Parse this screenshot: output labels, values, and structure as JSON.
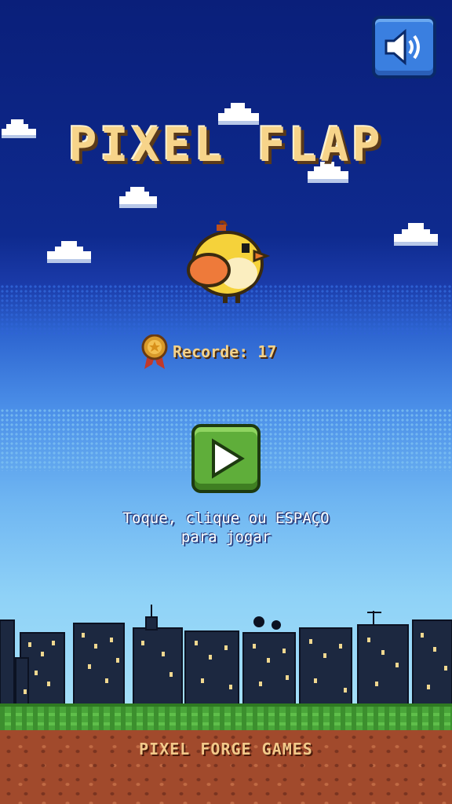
{
  "game": {
    "title": "PIXEL FLAP",
    "record_label": "Recorde: 17",
    "instructions_line1": "Toque, clique ou ESPAÇO",
    "instructions_line2": "para jogar",
    "footer": "PIXEL FORGE GAMES"
  },
  "icons": {
    "sound": "speaker-icon",
    "play": "play-icon",
    "medal": "medal-icon"
  },
  "colors": {
    "sky_top": "#0a1f7a",
    "sky_bottom": "#a4dff8",
    "title": "#f7d48a",
    "play_button": "#5fae3a",
    "sound_button": "#3a7fe0",
    "grass": "#4aa63a",
    "dirt": "#a14a2c"
  }
}
